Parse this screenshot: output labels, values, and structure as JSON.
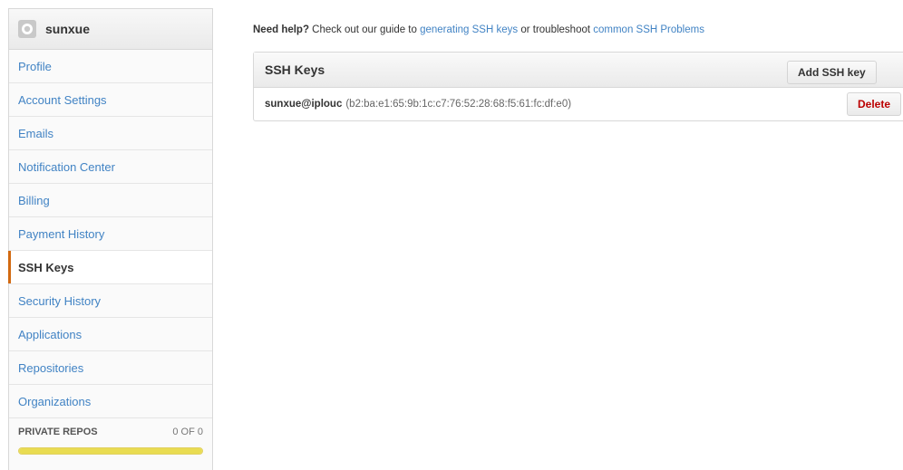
{
  "sidebar": {
    "username": "sunxue",
    "items": [
      {
        "label": "Profile",
        "selected": false
      },
      {
        "label": "Account Settings",
        "selected": false
      },
      {
        "label": "Emails",
        "selected": false
      },
      {
        "label": "Notification Center",
        "selected": false
      },
      {
        "label": "Billing",
        "selected": false
      },
      {
        "label": "Payment History",
        "selected": false
      },
      {
        "label": "SSH Keys",
        "selected": true
      },
      {
        "label": "Security History",
        "selected": false
      },
      {
        "label": "Applications",
        "selected": false
      },
      {
        "label": "Repositories",
        "selected": false
      },
      {
        "label": "Organizations",
        "selected": false
      }
    ],
    "private_repos": {
      "label": "PRIVATE REPOS",
      "count": "0 OF 0",
      "fill_fraction": 1.0
    }
  },
  "help": {
    "bold": "Need help?",
    "text1": " Check out our guide to ",
    "link1": "generating SSH keys",
    "text2": " or troubleshoot ",
    "link2": "common SSH Problems"
  },
  "ssh_keys": {
    "title": "SSH Keys",
    "add_label": "Add SSH key",
    "keys": [
      {
        "name": "sunxue@iplouc",
        "fingerprint": "(b2:ba:e1:65:9b:1c:c7:76:52:28:68:f5:61:fc:df:e0)",
        "delete_label": "Delete"
      }
    ]
  },
  "colors": {
    "link": "#4183c4",
    "selected_marker": "#d26911",
    "delete_text": "#bb0000",
    "progress": "#e9dc51"
  }
}
